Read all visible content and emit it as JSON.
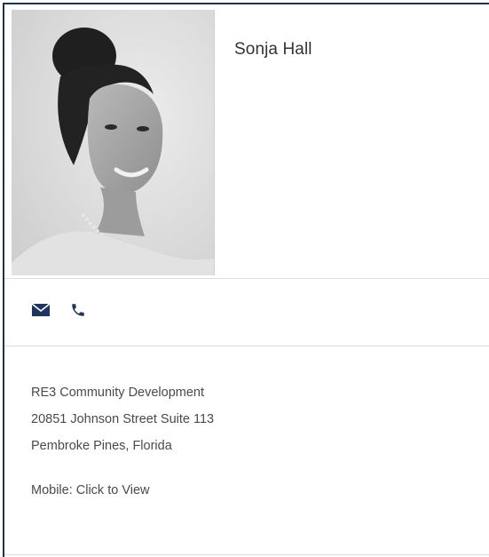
{
  "profile": {
    "name": "Sonja Hall"
  },
  "contact_icons": {
    "email_icon": "envelope-icon",
    "phone_icon": "phone-icon",
    "icon_color": "#1f3560"
  },
  "details": {
    "company": "RE3 Community Development",
    "address_line": "20851 Johnson Street Suite 113",
    "city_state": "Pembroke Pines, Florida",
    "mobile_label": "Mobile: Click to View"
  },
  "colors": {
    "border": "#1e3354",
    "text": "#4a4a4a",
    "name_text": "#333333",
    "divider": "#dcdcdc"
  }
}
